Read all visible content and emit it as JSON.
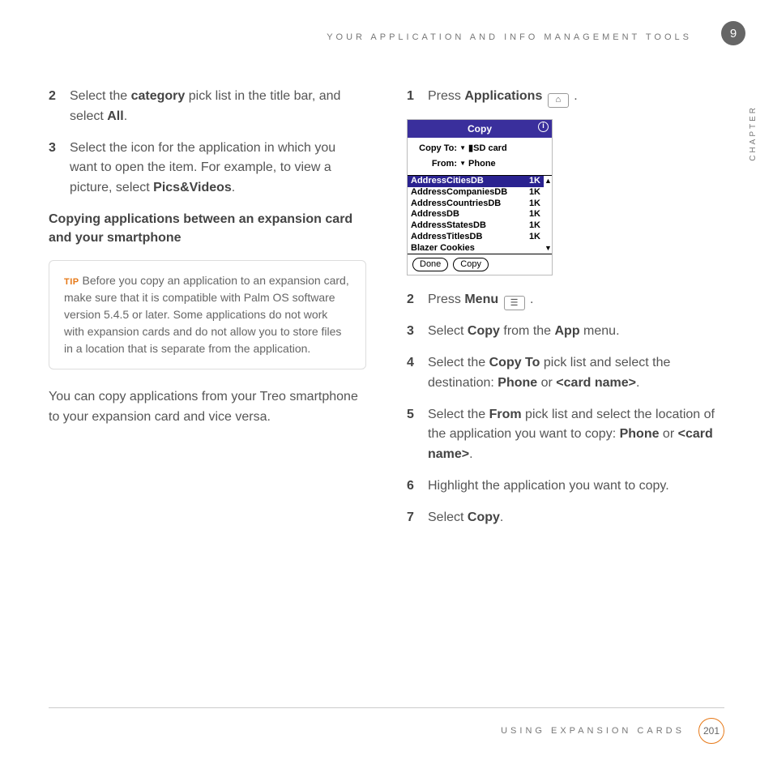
{
  "header": {
    "title": "YOUR APPLICATION AND INFO MANAGEMENT TOOLS"
  },
  "chapter": {
    "number": "9",
    "label": "CHAPTER"
  },
  "left": {
    "step2": {
      "pre": "Select the ",
      "b1": "category",
      "mid": " pick list in the title bar, and select ",
      "b2": "All",
      "post": "."
    },
    "step3": {
      "pre": "Select the icon for the application in which you want to open the item. For example, to view a picture, select ",
      "b1": "Pics&Videos",
      "post": "."
    },
    "subhead": "Copying applications between an expansion card and your smartphone",
    "tip": {
      "label": "TIP",
      "text": " Before you copy an application to an expansion card, make sure that it is compatible with Palm OS software version 5.4.5 or later. Some applications do not work with expansion cards and do not allow you to store files in a location that is separate from the application."
    },
    "para": "You can copy applications from your Treo smartphone to your expansion card and vice versa."
  },
  "right": {
    "step1": {
      "pre": "Press ",
      "b1": "Applications",
      "post": " "
    },
    "step2": {
      "pre": "Press ",
      "b1": "Menu",
      "post": " "
    },
    "step3": {
      "pre": "Select ",
      "b1": "Copy",
      "mid": " from the ",
      "b2": "App",
      "post": " menu."
    },
    "step4": {
      "pre": "Select the ",
      "b1": "Copy To",
      "mid": " pick list and select the destination: ",
      "b2": "Phone",
      "mid2": " or ",
      "b3": "<card name>",
      "post": "."
    },
    "step5": {
      "pre": "Select the ",
      "b1": "From",
      "mid": " pick list and select the location of the application you want to copy: ",
      "b2": "Phone",
      "mid2": " or ",
      "b3": "<card name>",
      "post": "."
    },
    "step6": {
      "text": "Highlight the application you want to copy."
    },
    "step7": {
      "pre": "Select ",
      "b1": "Copy",
      "post": "."
    }
  },
  "palm": {
    "title": "Copy",
    "copyto_label": "Copy To:",
    "copyto_value": "SD card",
    "from_label": "From:",
    "from_value": "Phone",
    "items": [
      {
        "name": "AddressCitiesDB",
        "size": "1K",
        "selected": true
      },
      {
        "name": "AddressCompaniesDB",
        "size": "1K"
      },
      {
        "name": "AddressCountriesDB",
        "size": "1K"
      },
      {
        "name": "AddressDB",
        "size": "1K"
      },
      {
        "name": "AddressStatesDB",
        "size": "1K"
      },
      {
        "name": "AddressTitlesDB",
        "size": "1K"
      },
      {
        "name": "Blazer Cookies",
        "size": ""
      }
    ],
    "done": "Done",
    "copy": "Copy"
  },
  "footer": {
    "section": "USING EXPANSION CARDS",
    "page": "201"
  }
}
